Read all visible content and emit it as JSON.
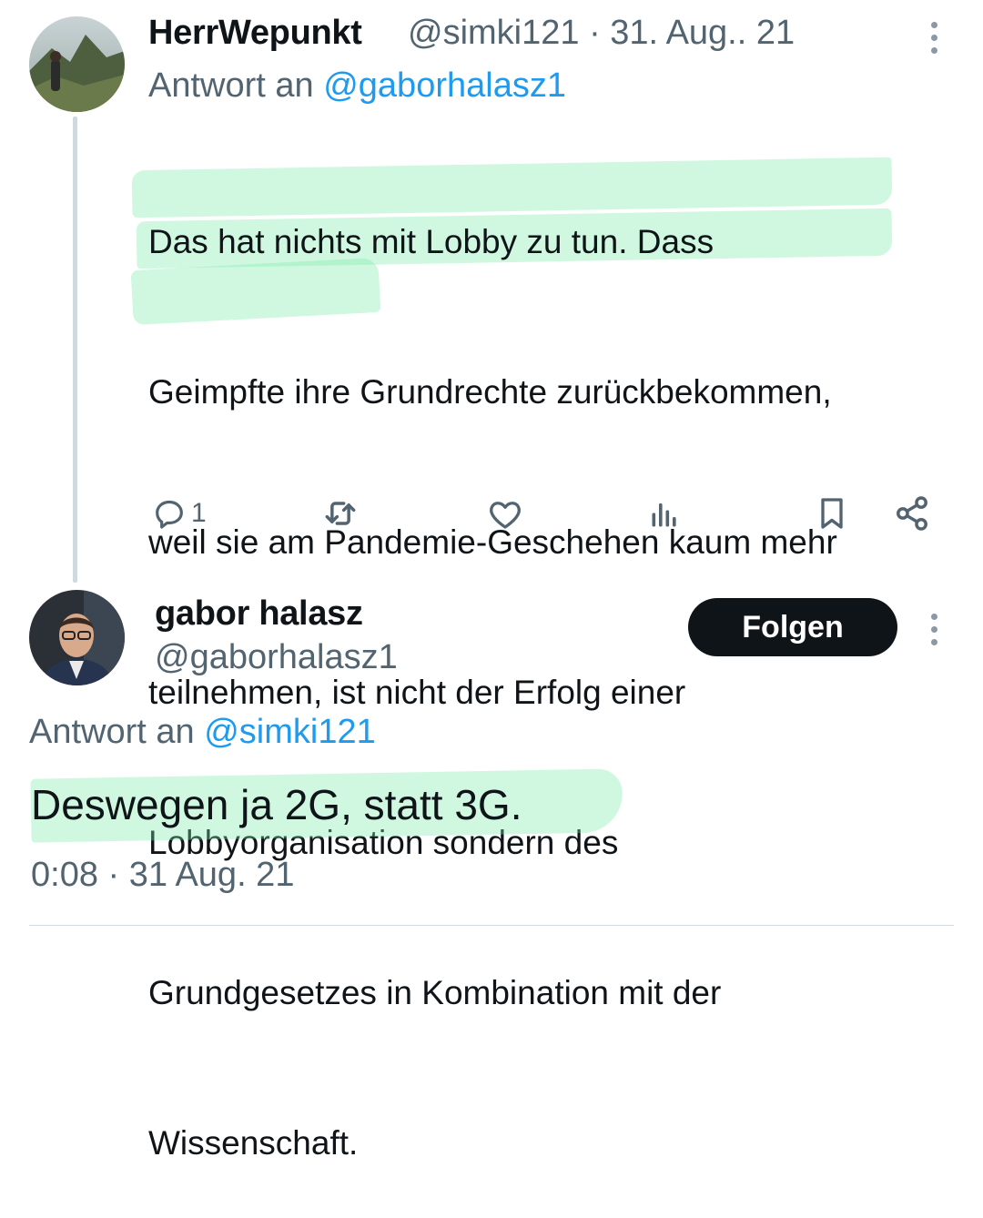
{
  "reply_tweet": {
    "display_name": "HerrWepunkt",
    "handle_date": "@simki121 · 31. Aug.. 21",
    "reply_prefix": "Antwort an ",
    "reply_to": "@gaborhalasz1",
    "lines": [
      "Das hat nichts mit Lobby zu tun. Dass",
      "Geimpfte ihre Grundrechte zurückbekommen,",
      "weil sie am Pandemie-Geschehen kaum mehr",
      "teilnehmen, ist nicht der Erfolg einer",
      "Lobbyorganisation sondern des",
      "Grundgesetzes in Kombination mit der",
      "Wissenschaft."
    ],
    "actions": {
      "reply_count": "1",
      "retweet_count": "",
      "like_count": "",
      "view_count": ""
    }
  },
  "main_tweet": {
    "display_name": "gabor halasz",
    "handle": "@gaborhalasz1",
    "follow_label": "Folgen",
    "reply_prefix": "Antwort an ",
    "reply_to": "@simki121",
    "text": "Deswegen ja 2G, statt 3G.",
    "timestamp": "0:08 · 31 Aug. 21"
  },
  "icons": [
    "more-icon",
    "reply-icon",
    "retweet-icon",
    "like-icon",
    "views-icon",
    "bookmark-icon",
    "share-icon"
  ],
  "colors": {
    "text": "#0f1419",
    "muted": "#536471",
    "link": "#1d9bf0",
    "highlight": "#78ebaa",
    "button": "#0f1419"
  }
}
